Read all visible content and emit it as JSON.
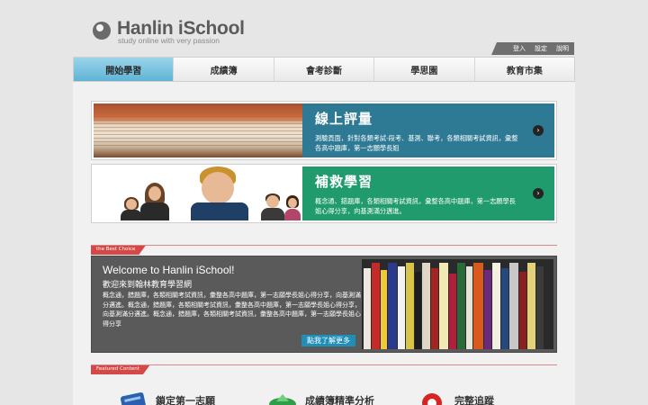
{
  "logo": {
    "title": "Hanlin iSchool",
    "subtitle": "study online with very passion"
  },
  "utility": [
    "登入",
    "設定",
    "說明"
  ],
  "nav": [
    {
      "label": "開始學習",
      "active": true
    },
    {
      "label": "成績簿",
      "active": false
    },
    {
      "label": "會考診斷",
      "active": false
    },
    {
      "label": "學思園",
      "active": false
    },
    {
      "label": "教育市集",
      "active": false
    }
  ],
  "cards": [
    {
      "title": "線上評量",
      "desc": "測驗頁面，針對各類考試-段考、基測、聯考，各類相關考試資訊，彙整各高中題庫，第一志願學長姐",
      "color": "#2e7a94"
    },
    {
      "title": "補救學習",
      "desc": "概念通、錯題庫，各類相關考試資訊，彙整各高中題庫，第一志願學長姐心得分享，向基測滿分邁進。",
      "color": "#1f9b6d"
    }
  ],
  "best_choice": {
    "tag": "the Best Choice",
    "title": "Welcome to Hanlin iSchool!",
    "subtitle": "歡迎來到翰林教育學習網",
    "body": "概念通，錯題庫，各類相關考試資訊，彙整各高中題庫，第一志願學長姐心得分享，向基測滿分邁進。概念通，錯題庫，各類相關考試資訊，彙整各高中題庫，第一志願學長姐心得分享，向基測滿分邁進。概念通，錯題庫，各類相關考試資訊，彙整各高中題庫，第一志願學長姐心得分享",
    "more": "點我了解更多"
  },
  "featured": {
    "tag": "Featured Content",
    "items": [
      {
        "label": "鎖定第一志願",
        "icon": "target-icon"
      },
      {
        "label": "成績簿精準分析",
        "icon": "analysis-icon"
      },
      {
        "label": "完整追蹤",
        "icon": "tracking-icon"
      }
    ]
  }
}
